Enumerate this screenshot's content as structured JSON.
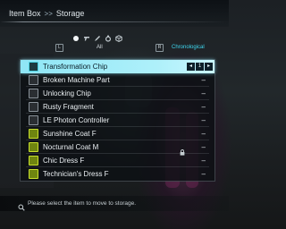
{
  "header": {
    "breadcrumb_root": "Item Box",
    "breadcrumb_sep": ">>",
    "breadcrumb_current": "Storage"
  },
  "filter_icons": [
    "dot-icon",
    "weapon-icon",
    "pen-icon",
    "ring-icon",
    "cube-icon"
  ],
  "tabs": {
    "left_key": "L",
    "right_key": "R",
    "all_label": "All",
    "sort_label": "Chronological"
  },
  "items": [
    {
      "name": "Transformation Chip",
      "qty": "",
      "icon": "chip",
      "selected": true
    },
    {
      "name": "Broken Machine Part",
      "qty": "–",
      "icon": "part"
    },
    {
      "name": "Unlocking Chip",
      "qty": "–",
      "icon": "part"
    },
    {
      "name": "Rusty Fragment",
      "qty": "–",
      "icon": "part"
    },
    {
      "name": "LE Photon Controller",
      "qty": "–",
      "icon": "part"
    },
    {
      "name": "Sunshine Coat F",
      "qty": "–",
      "icon": "coat"
    },
    {
      "name": "Nocturnal Coat M",
      "qty": "–",
      "icon": "coat",
      "locked": true
    },
    {
      "name": "Chic Dress F",
      "qty": "–",
      "icon": "coat"
    },
    {
      "name": "Technician's Dress F",
      "qty": "–",
      "icon": "coat"
    }
  ],
  "selected_controls": {
    "left": "◂",
    "count": "1",
    "right": "▸"
  },
  "footer": {
    "hint": "Please select the item to move to storage."
  },
  "colors": {
    "accent": "#3fd8f0",
    "selected_row": "#aef0fa",
    "coat_icon": "#c8e02c"
  }
}
